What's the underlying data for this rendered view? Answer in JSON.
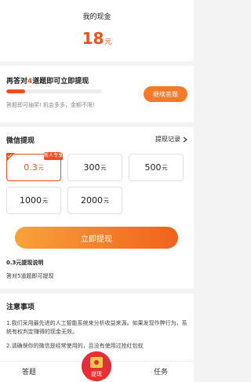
{
  "balance": {
    "title": "我的现金",
    "amount": "18",
    "unit": "元"
  },
  "quiz": {
    "prefix": "再答对",
    "count": "4",
    "suffix": "道题即可立即提现",
    "hint": "答题即可抽奖! 机会多多，金额不限!",
    "continue_label": "继续答题",
    "progress_percent": 20
  },
  "withdraw": {
    "title": "微信提现",
    "records_label": "提现记录",
    "new_user_badge": "新人专享",
    "options": [
      {
        "amount": "0.3",
        "unit": "元",
        "selected": true
      },
      {
        "amount": "300",
        "unit": "元",
        "selected": false
      },
      {
        "amount": "500",
        "unit": "元",
        "selected": false
      },
      {
        "amount": "1000",
        "unit": "元",
        "selected": false
      },
      {
        "amount": "2000",
        "unit": "元",
        "selected": false
      }
    ],
    "button_label": "立即提现",
    "explain_title": "0.3元提现说明",
    "explain_sub": "答对5道题即可提现"
  },
  "notes": {
    "title": "注意事项",
    "items": [
      "1.我们采用最先进的人工智能系统来分析收益来源。如果发现作弊行为，系统有权判定赚得的现金无效。",
      "2.请确保你的微信是经常使用的，且没有使用过抢红包软"
    ]
  },
  "tabbar": {
    "answer": "答题",
    "withdraw": "提现",
    "task": "任务"
  },
  "colors": {
    "accent": "#f0511c",
    "button_start": "#f8a23a",
    "button_end": "#f0621c"
  }
}
